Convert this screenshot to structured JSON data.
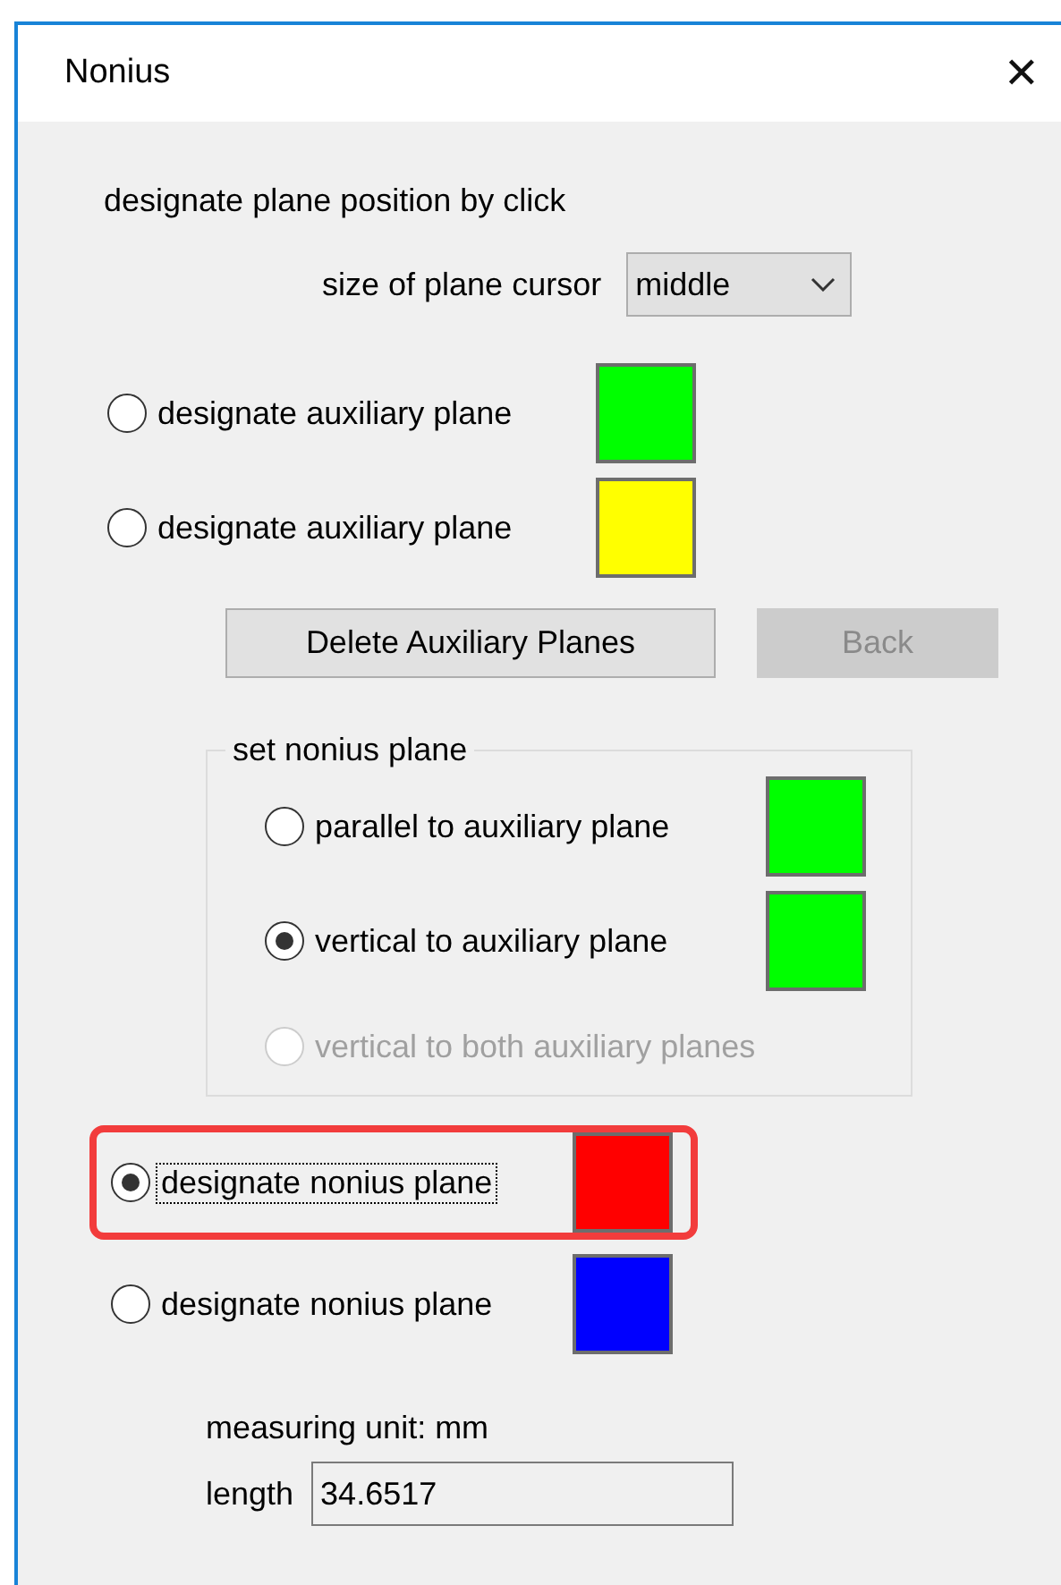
{
  "window": {
    "title": "Nonius",
    "close": "✕"
  },
  "instruction": "designate plane position by click",
  "cursor_size": {
    "label": "size of plane cursor",
    "value": "middle"
  },
  "auxiliary_planes": [
    {
      "label": "designate auxiliary plane",
      "selected": false,
      "color": "#00ff00"
    },
    {
      "label": "designate auxiliary plane",
      "selected": false,
      "color": "#ffff00"
    }
  ],
  "buttons": [
    {
      "label": "Delete Auxiliary Planes",
      "disabled": false
    },
    {
      "label": "Back",
      "disabled": true
    }
  ],
  "nonius_group": {
    "title": "set nonius plane",
    "options": [
      {
        "kind": "swatch",
        "label": "parallel to auxiliary plane",
        "selected": false,
        "disabled": false,
        "color": "#00ff00"
      },
      {
        "kind": "swatch",
        "label": "vertical to auxiliary plane",
        "selected": true,
        "disabled": false,
        "color": "#00ff00"
      },
      {
        "kind": "plain",
        "label": "vertical to both auxiliary planes",
        "selected": false,
        "disabled": true
      }
    ]
  },
  "nonius_planes": [
    {
      "label": "designate nonius plane",
      "selected": true,
      "focused": true,
      "highlighted": true,
      "color": "#ff0000"
    },
    {
      "label": "designate nonius plane",
      "selected": false,
      "focused": false,
      "highlighted": false,
      "color": "#0000ff"
    }
  ],
  "measuring_unit": "measuring unit: mm",
  "length": {
    "label": "length",
    "value": "34.6517"
  }
}
